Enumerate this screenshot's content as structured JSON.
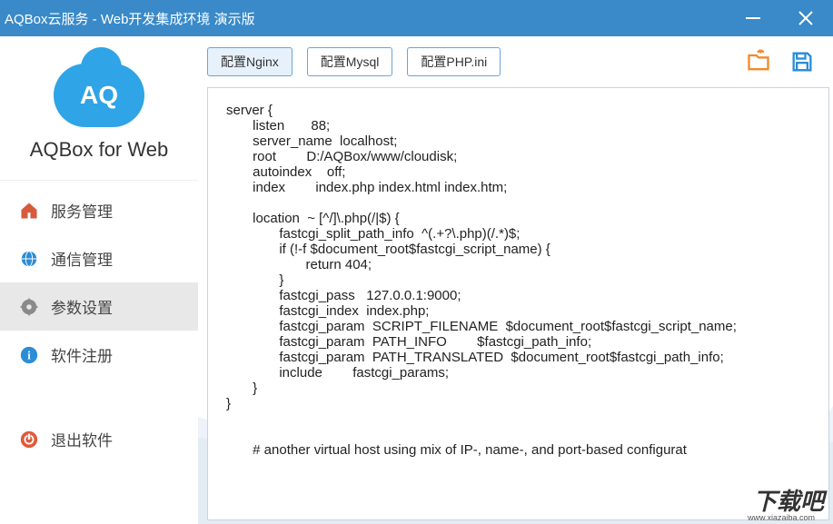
{
  "window": {
    "title": "AQBox云服务 - Web开发集成环境 演示版"
  },
  "logo": {
    "cloud_text": "AQ",
    "brand": "AQBox for Web"
  },
  "sidebar": {
    "items": [
      {
        "label": "服务管理",
        "icon": "home",
        "active": false
      },
      {
        "label": "通信管理",
        "icon": "globe",
        "active": false
      },
      {
        "label": "参数设置",
        "icon": "gear",
        "active": true
      },
      {
        "label": "软件注册",
        "icon": "info",
        "active": false
      }
    ],
    "exit": {
      "label": "退出软件",
      "icon": "power"
    }
  },
  "toolbar": {
    "buttons": [
      {
        "label": "配置Nginx",
        "active": true
      },
      {
        "label": "配置Mysql",
        "active": false
      },
      {
        "label": "配置PHP.ini",
        "active": false
      }
    ]
  },
  "editor": {
    "content": "server {\n       listen       88;\n       server_name  localhost;\n       root        D:/AQBox/www/cloudisk;\n       autoindex    off;\n       index        index.php index.html index.htm;\n\n       location  ~ [^/]\\.php(/|$) {\n              fastcgi_split_path_info  ^(.+?\\.php)(/.*)$;\n              if (!-f $document_root$fastcgi_script_name) {\n                     return 404;\n              }\n              fastcgi_pass   127.0.0.1:9000;\n              fastcgi_index  index.php;\n              fastcgi_param  SCRIPT_FILENAME  $document_root$fastcgi_script_name;\n              fastcgi_param  PATH_INFO        $fastcgi_path_info;\n              fastcgi_param  PATH_TRANSLATED  $document_root$fastcgi_path_info;\n              include        fastcgi_params;\n       }\n}\n\n\n       # another virtual host using mix of IP-, name-, and port-based configurat"
  },
  "watermark": {
    "text": "下载吧",
    "url": "www.xiazaiba.com"
  }
}
